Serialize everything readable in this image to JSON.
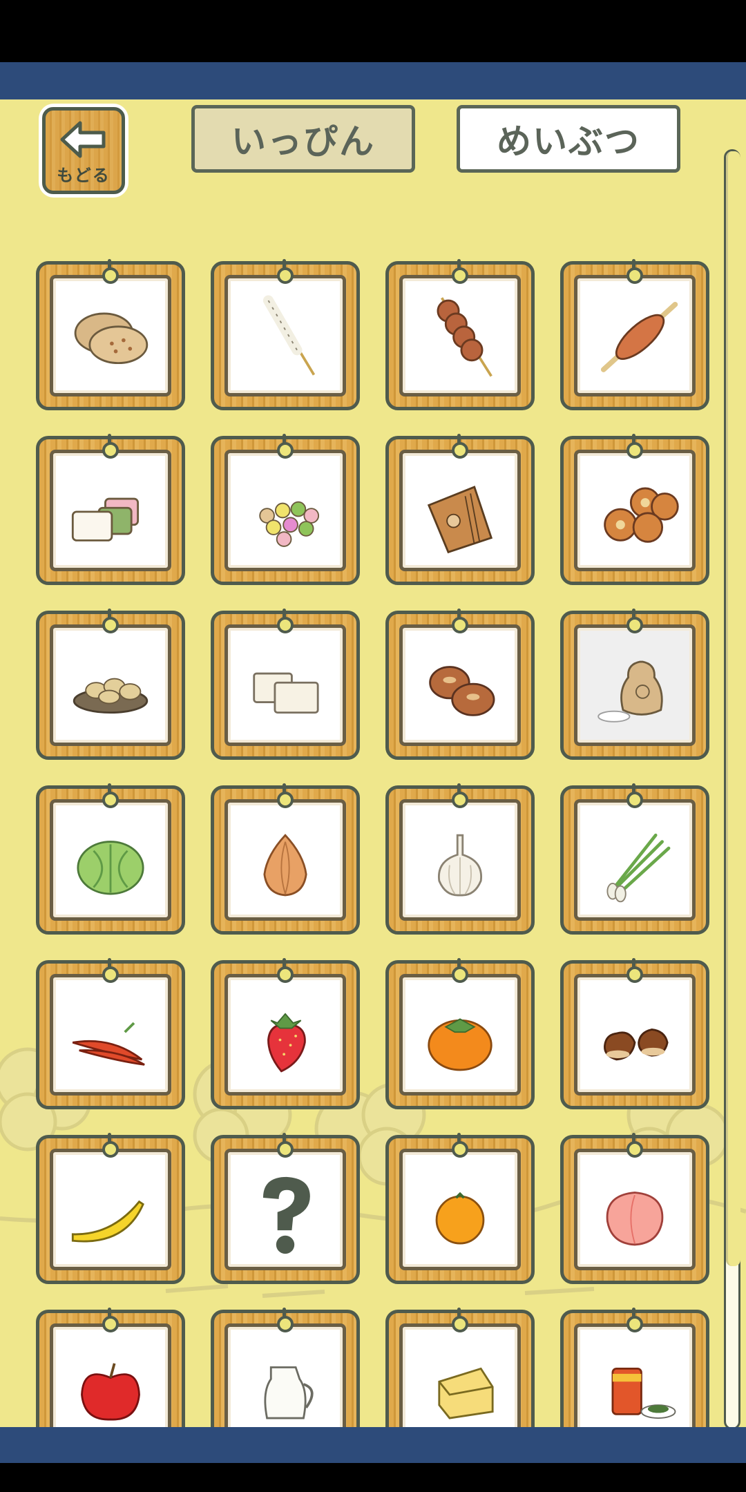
{
  "header": {
    "back_label": "もどる",
    "tabs": [
      {
        "label": "いっぴん",
        "state": "selected"
      },
      {
        "label": "めいぶつ",
        "state": "unselected"
      }
    ]
  },
  "colors": {
    "background": "#efe78c",
    "top_band": "#2d4b7a",
    "card_frame": "#e0a94b",
    "outline": "#4f5b4d"
  },
  "grid": {
    "columns": 4,
    "items": [
      {
        "icon": "rice-cracker-icon"
      },
      {
        "icon": "candy-stick-icon"
      },
      {
        "icon": "dango-skewer-icon"
      },
      {
        "icon": "grilled-mochi-skewer-icon"
      },
      {
        "icon": "layered-sweets-icon"
      },
      {
        "icon": "colorful-candy-balls-icon"
      },
      {
        "icon": "senbei-packet-icon"
      },
      {
        "icon": "steamed-buns-icon"
      },
      {
        "icon": "snack-plate-icon"
      },
      {
        "icon": "tofu-blocks-icon"
      },
      {
        "icon": "manju-buns-icon"
      },
      {
        "icon": "rice-bag-icon"
      },
      {
        "icon": "cabbage-icon"
      },
      {
        "icon": "onion-icon"
      },
      {
        "icon": "garlic-icon"
      },
      {
        "icon": "green-onion-icon"
      },
      {
        "icon": "red-peppers-icon"
      },
      {
        "icon": "strawberry-icon"
      },
      {
        "icon": "persimmon-icon"
      },
      {
        "icon": "chestnuts-icon"
      },
      {
        "icon": "banana-icon"
      },
      {
        "icon": "unknown-question-icon",
        "text": "?"
      },
      {
        "icon": "mandarin-orange-icon"
      },
      {
        "icon": "peach-icon"
      },
      {
        "icon": "apple-icon"
      },
      {
        "icon": "milk-pitcher-icon"
      },
      {
        "icon": "cheese-icon"
      },
      {
        "icon": "tea-canister-icon"
      }
    ]
  }
}
